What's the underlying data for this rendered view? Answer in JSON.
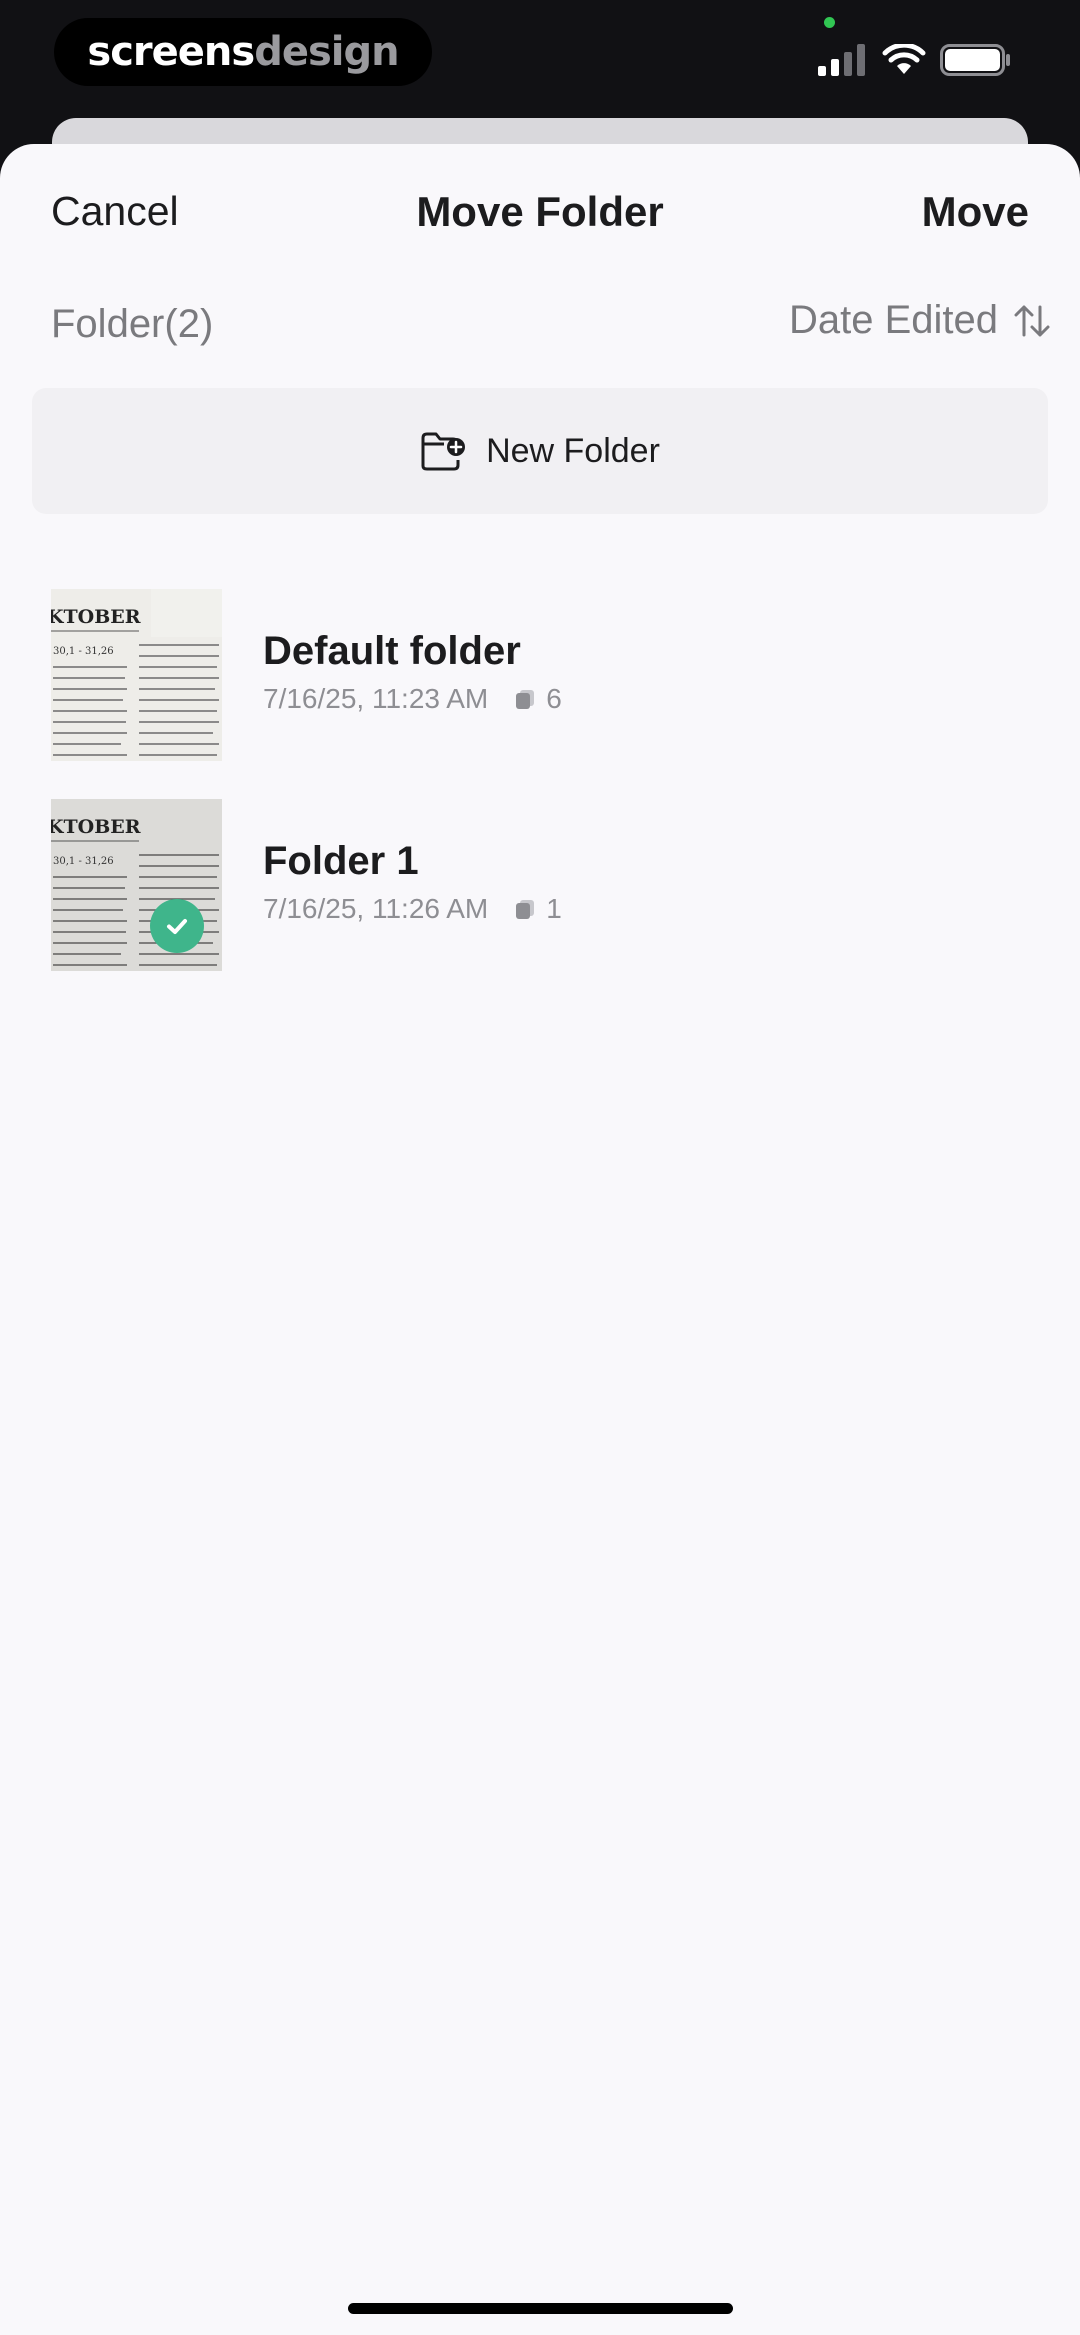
{
  "status_bar": {
    "brand_part1": "screens",
    "brand_part2": "design",
    "icons": [
      "signal-icon",
      "wifi-icon",
      "battery-icon"
    ]
  },
  "nav": {
    "cancel_label": "Cancel",
    "title": "Move Folder",
    "move_label": "Move"
  },
  "list_header": {
    "folder_count": "Folder(2)",
    "sort_label": "Date Edited",
    "sort_icon": "sort-arrows-icon"
  },
  "new_folder": {
    "label": "New Folder",
    "icon": "folder-add-icon"
  },
  "folders": [
    {
      "name": "Default folder",
      "date": "7/16/25, 11:23 AM",
      "count": "6",
      "selected": false,
      "thumb_heading": "KTOBER",
      "thumb_ref": "30,1 - 31,26"
    },
    {
      "name": "Folder 1",
      "date": "7/16/25, 11:26 AM",
      "count": "1",
      "selected": true,
      "thumb_heading": "KTOBER",
      "thumb_ref": "30,1 - 31,26"
    }
  ],
  "colors": {
    "sheet_background": "#f9f8fb",
    "text_primary": "#1c1c1e",
    "text_secondary": "#8e8e93",
    "selected_badge": "#3fb58b"
  }
}
